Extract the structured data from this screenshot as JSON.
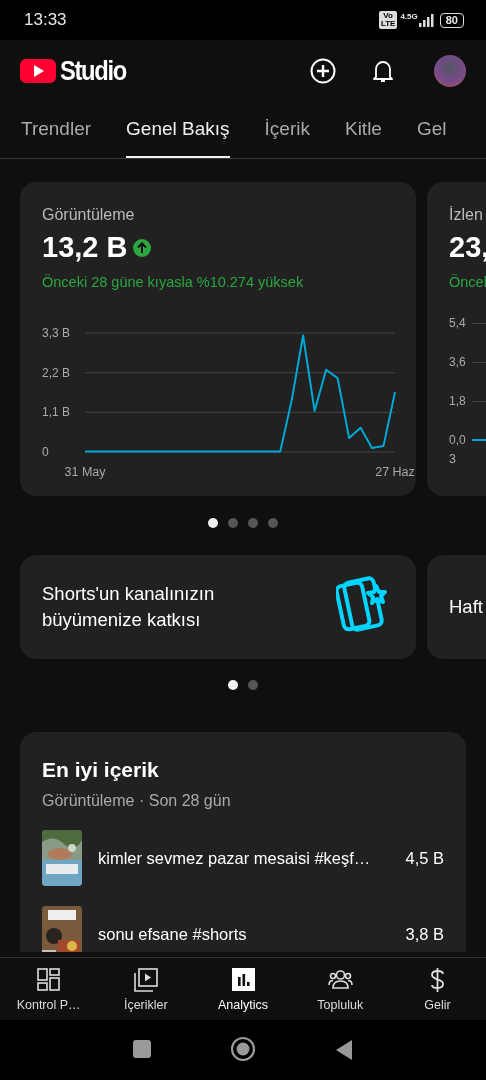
{
  "status_bar": {
    "time": "13:33",
    "volte": [
      "Vo",
      "LTE"
    ],
    "network": "4.5G",
    "battery": "80"
  },
  "header": {
    "logo_text": "Studio"
  },
  "tabs": [
    {
      "label": "Trendler",
      "selected": false
    },
    {
      "label": "Genel Bakış",
      "selected": true
    },
    {
      "label": "İçerik",
      "selected": false
    },
    {
      "label": "Kitle",
      "selected": false
    },
    {
      "label": "Gel",
      "selected": false
    }
  ],
  "metric_cards": [
    {
      "kind": "full",
      "title": "Görüntüleme",
      "value": "13,2 B",
      "increased": true,
      "comparison": "Önceki 28 güne kıyasla %10.274 yüksek",
      "chart_data": {
        "type": "line",
        "categories": [
          "31 May",
          null,
          null,
          null,
          null,
          null,
          null,
          null,
          null,
          null,
          null,
          null,
          null,
          null,
          null,
          null,
          null,
          null,
          null,
          null,
          null,
          null,
          null,
          null,
          null,
          null,
          null,
          "27 Haz"
        ],
        "ylim": [
          0,
          3.3
        ],
        "yticks": [
          {
            "value": 0,
            "label": "0"
          },
          {
            "value": 1.1,
            "label": "1,1 B"
          },
          {
            "value": 2.2,
            "label": "2,2 B"
          },
          {
            "value": 3.3,
            "label": "3,3 B"
          }
        ],
        "series": [
          {
            "color": "#00a8d6",
            "values": [
              0.01,
              0.01,
              0.01,
              0.01,
              0.01,
              0.01,
              0.01,
              0.01,
              0.01,
              0.01,
              0.01,
              0.01,
              0.01,
              0.01,
              0.01,
              0.01,
              0.01,
              0.01,
              1.44,
              3.23,
              1.14,
              2.28,
              2.05,
              0.39,
              0.67,
              0.11,
              0.17,
              1.66
            ]
          }
        ]
      }
    },
    {
      "kind": "peek",
      "title": "İzlen",
      "value": "23,",
      "comparison": "Öncel",
      "y_ticks": [
        "5,4",
        "3,6",
        "1,8",
        "0,0"
      ],
      "x_label": "3"
    }
  ],
  "metric_dots": [
    {
      "selected": true
    },
    {
      "selected": false
    },
    {
      "selected": false
    },
    {
      "selected": false
    }
  ],
  "promo_cards": [
    {
      "text": "Shorts'un kanalınızın büyümenize katkısı",
      "kind": "shorts"
    },
    {
      "text": "Haft",
      "kind": "peek"
    }
  ],
  "promo_dots": [
    {
      "selected": true
    },
    {
      "selected": false
    }
  ],
  "top_content": {
    "title": "En iyi içerik",
    "subtitle": "Görüntüleme · Son 28 gün",
    "items": [
      {
        "title": "kimler sevmez pazar mesaisi #keşf…",
        "views": "4,5 B"
      },
      {
        "title": "sonu efsane #shorts",
        "views": "3,8 B"
      }
    ]
  },
  "bottom_nav": [
    {
      "kind": "dashboard",
      "label": "Kontrol P…",
      "selected": false
    },
    {
      "kind": "content",
      "label": "İçerikler",
      "selected": false
    },
    {
      "kind": "analytics",
      "label": "Analytics",
      "selected": true
    },
    {
      "kind": "community",
      "label": "Topluluk",
      "selected": false
    },
    {
      "kind": "earn",
      "label": "Gelir",
      "selected": false
    }
  ]
}
